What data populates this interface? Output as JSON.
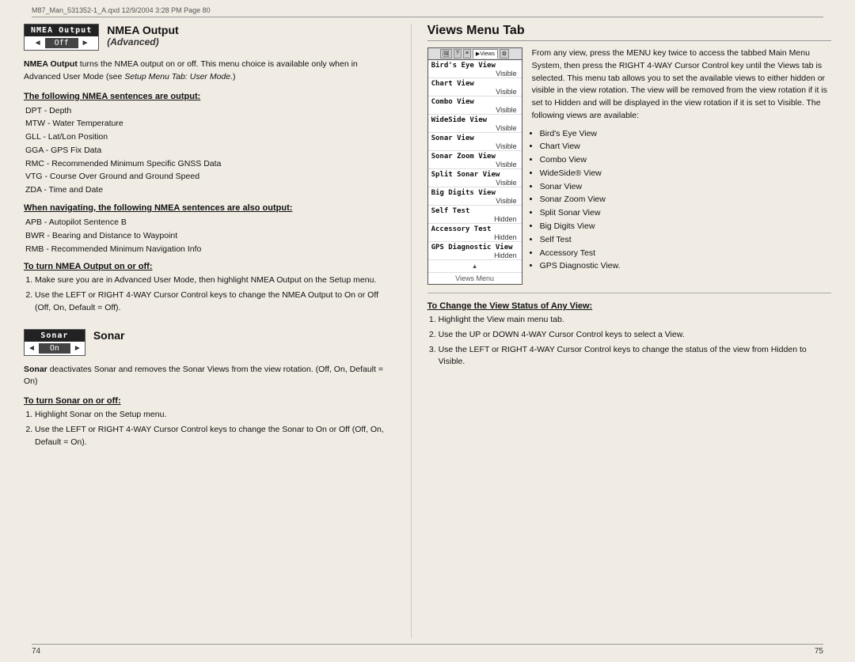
{
  "header": {
    "text": "M87_Man_531352-1_A.qxd   12/9/2004   3:28 PM   Page 80"
  },
  "footer": {
    "left_page": "74",
    "right_page": "75"
  },
  "left_column": {
    "nmea_section": {
      "box_title": "NMEA Output",
      "box_value": "Off",
      "arrow_left": "◄",
      "arrow_right": "►",
      "main_title": "NMEA Output",
      "main_subtitle": "(Advanced)",
      "description": "NMEA Output turns the NMEA output on or off.  This menu choice is available only when in Advanced User Mode (see Setup Menu Tab: User Mode.)",
      "sentences_heading": "The following NMEA sentences are output:",
      "sentences": [
        "DPT - Depth",
        "MTW - Water Temperature",
        "GLL - Lat/Lon Position",
        "GGA - GPS Fix Data",
        "RMC - Recommended Minimum Specific GNSS Data",
        "VTG - Course Over Ground and Ground Speed",
        "ZDA - Time and Date"
      ],
      "navigating_heading": "When navigating, the following NMEA sentences are also output:",
      "navigating_sentences": [
        "APB - Autopilot Sentence B",
        "BWR - Bearing and Distance to Waypoint",
        "RMB - Recommended Minimum Navigation Info"
      ],
      "turn_on_off_heading": "To turn NMEA Output on or off:",
      "steps": [
        "Make sure you are in Advanced User Mode, then highlight NMEA Output on the Setup menu.",
        "Use the LEFT or RIGHT 4-WAY Cursor Control keys to change the NMEA Output to On or Off (Off, On, Default = Off)."
      ]
    },
    "sonar_section": {
      "box_title": "Sonar",
      "box_value": "On",
      "arrow_left": "◄",
      "arrow_right": "►",
      "main_title": "Sonar",
      "description_bold": "Sonar",
      "description": " deactivates Sonar and removes the Sonar Views from the view rotation. (Off, On, Default = On)",
      "turn_on_off_heading": "To turn Sonar on or off:",
      "steps": [
        "Highlight Sonar on the Setup menu.",
        "Use the LEFT or RIGHT 4-WAY Cursor Control keys to change the Sonar to On or Off (Off, On, Default = On)."
      ]
    }
  },
  "right_column": {
    "views_panel": {
      "tabs": [
        "🖼",
        "?",
        "≡",
        "▶Views",
        "⚙"
      ],
      "items": [
        {
          "name": "Bird's Eye View",
          "status": "Visible"
        },
        {
          "name": "Chart View",
          "status": "Visible"
        },
        {
          "name": "Combo View",
          "status": "Visible"
        },
        {
          "name": "WideSide View",
          "status": "Visible"
        },
        {
          "name": "Sonar View",
          "status": "Visible"
        },
        {
          "name": "Sonar Zoom View",
          "status": "Visible"
        },
        {
          "name": "Split Sonar View",
          "status": "Visible"
        },
        {
          "name": "Big Digits View",
          "status": "Visible"
        },
        {
          "name": "Self Test",
          "status": "Hidden"
        },
        {
          "name": "Accessory Test",
          "status": "Hidden"
        },
        {
          "name": "GPS Diagnostic View",
          "status": "Hidden"
        }
      ],
      "label": "Views Menu"
    },
    "title": "Views Menu Tab",
    "description": "From any view, press the MENU key twice to access the tabbed Main Menu System, then press the RIGHT 4-WAY Cursor Control key until the Views tab is selected. This menu tab allows you to set the available views to either hidden or visible in the view rotation.  The view will be removed from the view rotation if it is set to Hidden and will be displayed in the view rotation if it is set to Visible. The following views are available:",
    "available_views": [
      "Bird's Eye View",
      "Chart View",
      "Combo View",
      "WideSide® View",
      "Sonar View",
      "Sonar Zoom View",
      "Split Sonar View",
      "Big Digits View",
      "Self Test",
      "Accessory Test",
      "GPS Diagnostic View."
    ],
    "change_status_heading": "To Change the View Status of Any View:",
    "change_steps": [
      "Highlight the View main menu tab.",
      "Use the UP or DOWN 4-WAY Cursor Control keys to select a View.",
      "Use the LEFT or RIGHT 4-WAY Cursor Control keys to change the status of the view from Hidden to Visible."
    ]
  }
}
